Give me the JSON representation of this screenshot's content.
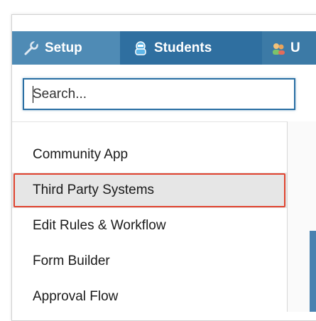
{
  "topnav": {
    "tabs": [
      {
        "label": "Setup",
        "icon": "wrench-icon"
      },
      {
        "label": "Students",
        "icon": "student-icon"
      },
      {
        "label": "U",
        "icon": "users-icon"
      }
    ]
  },
  "search": {
    "placeholder": "Search...",
    "value": ""
  },
  "menu": {
    "items": [
      {
        "label": "Community App"
      },
      {
        "label": "Third Party Systems",
        "selected": true
      },
      {
        "label": "Edit Rules & Workflow"
      },
      {
        "label": "Form Builder"
      },
      {
        "label": "Approval Flow"
      }
    ]
  },
  "colors": {
    "nav_bg": "#3c7aa6",
    "nav_setup_bg": "#4f8bb5",
    "nav_students_bg": "#2f6fa0",
    "search_border": "#2a6fa3",
    "highlight_border": "#e0432f",
    "selected_bg": "#e6e6e6"
  }
}
